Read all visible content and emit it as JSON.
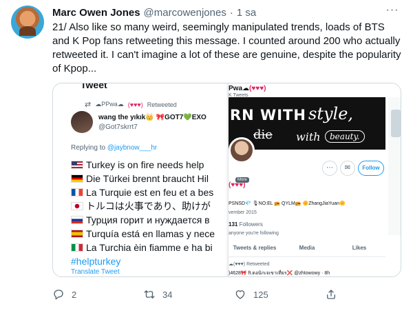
{
  "author": {
    "name": "Marc Owen Jones",
    "handle": "@marcowenjones",
    "separator": "·",
    "time": "1 sa"
  },
  "tweet_text": "21/ Also like so many weird, seemingly manipulated trends, loads of BTS and K Pop fans retweeting this message. I counted around 200 who actually retweeted it. I can't imagine a lot of these are genuine, despite the popularity of Kpop...",
  "more_glyph": "···",
  "left_shot": {
    "top_cut": "Tweet",
    "retweet_by": "☁PPwa☁",
    "retweet_hearts": "(♥♥♥)",
    "retweet_label": "Retweeted",
    "name": "wang the yıkık👑 🎀GOT7💚EXO",
    "handle": "@Got7skrrt7",
    "replying_prefix": "Replying to",
    "replying_link": "@jaybnow___hr",
    "lines": [
      "Turkey is on fire needs help",
      "Die Türkei brennt braucht Hil",
      "La Turquie est en feu et a bes",
      "トルコは火事であり、助けが",
      "Турция горит и нуждается в",
      "Turquía está en llamas y nece",
      "La Turchia èin fiamme e ha bi"
    ],
    "hashtag": "#helpturkey",
    "translate": "Translate Tweet"
  },
  "right_shot": {
    "name": "Pwa☁",
    "name_hearts": "(♥♥♥)",
    "sub": "K Tweets",
    "banner_1": "RN WITH",
    "banner_2": "style,",
    "banner_3": "die",
    "banner_4": "with",
    "banner_5": "beauty.",
    "follow_label": "Follow",
    "more_label": "More",
    "name2": "(♥♥♥)",
    "bio": "PSNSD💎 🎙NO:EL 📻 QYLM📻 🌼ZhangJiaYuan🌼",
    "joined": "vember 2015",
    "followers_count": "131",
    "followers_label": "Followers",
    "known": "anyone you're following",
    "tabs": [
      "Tweets & replies",
      "Media",
      "Likes"
    ],
    "rt_line": "☁(♥♥♥) Retweeted",
    "bottom_line": ")4628🎀 ft.ดอนิกเจเขาเที่ยร❌ @zhtowowy · 8h"
  },
  "actions": {
    "reply_count": "2",
    "retweet_count": "34",
    "like_count": "125"
  }
}
